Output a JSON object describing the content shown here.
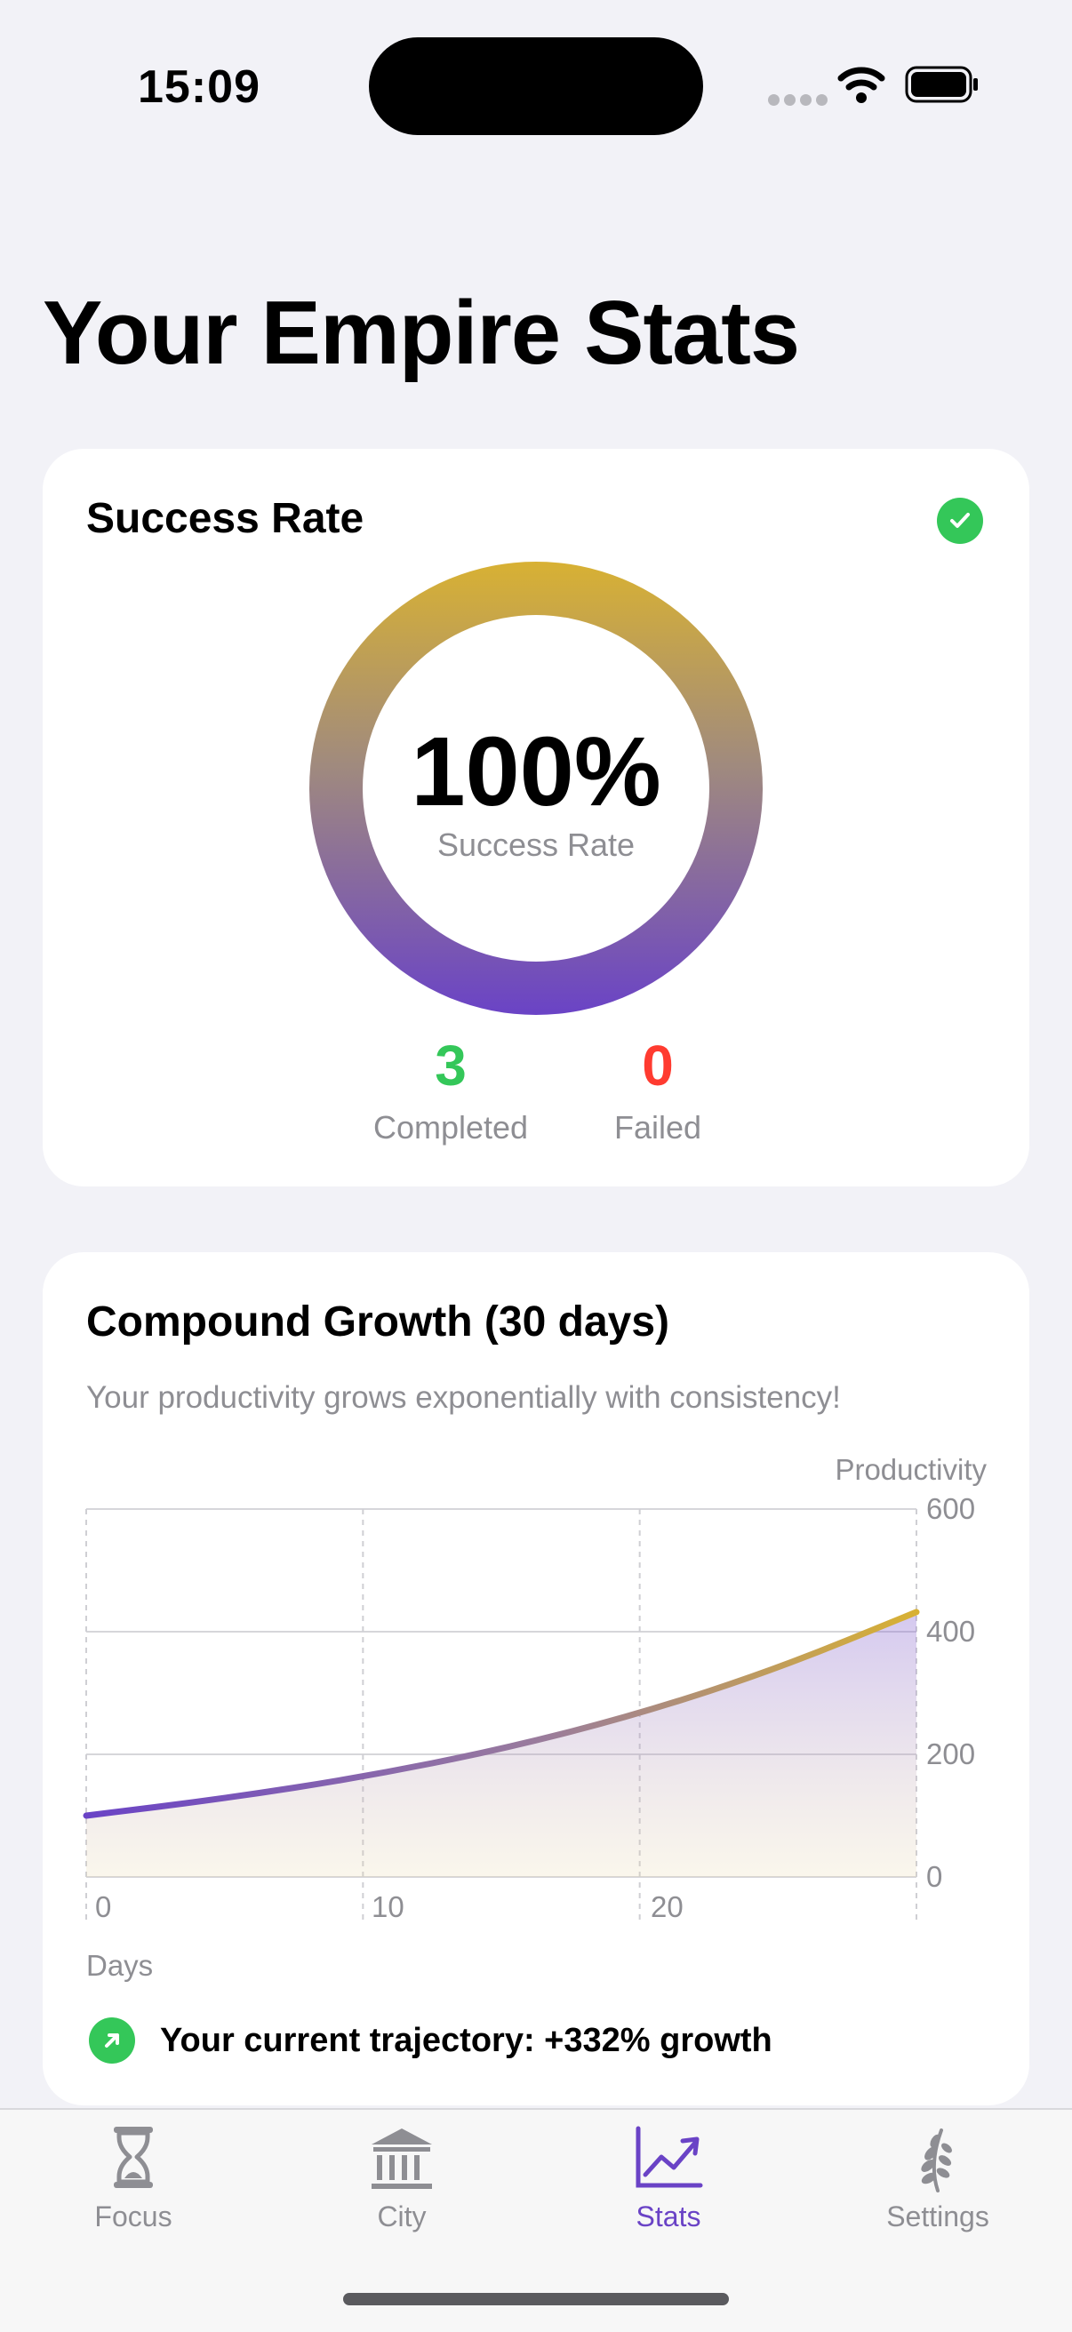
{
  "status_bar": {
    "time": "15:09"
  },
  "page_title": "Your Empire Stats",
  "success_card": {
    "title": "Success Rate",
    "percent": "100%",
    "percent_label": "Success Rate",
    "completed_value": "3",
    "completed_label": "Completed",
    "failed_value": "0",
    "failed_label": "Failed",
    "ring_progress": 1.0
  },
  "growth_card": {
    "title": "Compound Growth (30 days)",
    "subtitle": "Your productivity grows exponentially with consistency!",
    "trajectory": "Your current trajectory: +332% growth"
  },
  "chart_data": {
    "type": "area",
    "xlabel": "Days",
    "ylabel": "Productivity",
    "x_ticks": [
      "0",
      "10",
      "20"
    ],
    "y_ticks": [
      "600",
      "400",
      "200",
      "0"
    ],
    "xlim": [
      0,
      30
    ],
    "ylim": [
      0,
      600
    ],
    "grid": true,
    "series": [
      {
        "x": [
          0,
          5,
          10,
          15,
          20,
          25,
          30
        ],
        "y": [
          100,
          128,
          163,
          208,
          266,
          340,
          432
        ]
      }
    ]
  },
  "colors": {
    "accent": "#6a43c6",
    "gold": "#d8b133",
    "success": "#34c759",
    "failure": "#ff3b30"
  },
  "tabbar": {
    "items": [
      {
        "label": "Focus",
        "icon": "hourglass-icon"
      },
      {
        "label": "City",
        "icon": "bank-icon"
      },
      {
        "label": "Stats",
        "icon": "chart-trend-icon"
      },
      {
        "label": "Settings",
        "icon": "laurel-icon"
      }
    ],
    "active": "Stats"
  }
}
